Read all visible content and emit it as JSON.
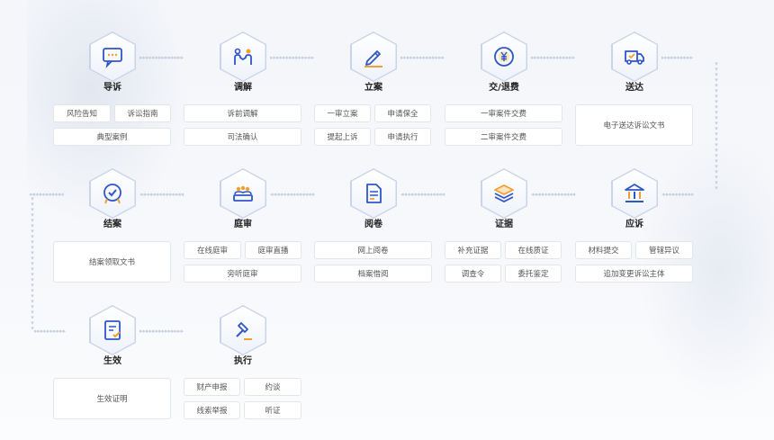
{
  "stages": [
    {
      "key": "daosu",
      "label": "导诉",
      "icon": "chat-icon",
      "tags": [
        "风险告知",
        "诉讼指南",
        "典型案例"
      ]
    },
    {
      "key": "tiaojie",
      "label": "调解",
      "icon": "mediation-icon",
      "tags": [
        "诉前调解",
        "司法确认"
      ]
    },
    {
      "key": "lian",
      "label": "立案",
      "icon": "pen-icon",
      "tags": [
        "一审立案",
        "申请保全",
        "提起上诉",
        "申请执行"
      ]
    },
    {
      "key": "jiaotuifei",
      "label": "交/退费",
      "icon": "yuan-icon",
      "tags": [
        "一审案件交费",
        "二审案件交费"
      ]
    },
    {
      "key": "songda",
      "label": "送达",
      "icon": "delivery-truck-icon",
      "tags": [
        "电子送达诉讼文书"
      ]
    },
    {
      "key": "yingsu",
      "label": "应诉",
      "icon": "courthouse-icon",
      "tags": [
        "材料提交",
        "管辖异议",
        "追加变更诉讼主体"
      ]
    },
    {
      "key": "zhengju",
      "label": "证据",
      "icon": "layers-icon",
      "tags": [
        "补充证据",
        "在线质证",
        "调查令",
        "委托鉴定"
      ]
    },
    {
      "key": "yuejuan",
      "label": "阅卷",
      "icon": "document-icon",
      "tags": [
        "网上阅卷",
        "档案借阅"
      ]
    },
    {
      "key": "tingshen",
      "label": "庭审",
      "icon": "courtroom-icon",
      "tags": [
        "在线庭审",
        "庭审直播",
        "旁听庭审"
      ]
    },
    {
      "key": "jiean",
      "label": "结案",
      "icon": "check-badge-icon",
      "tags": [
        "结案领取文书"
      ]
    },
    {
      "key": "shengxiao",
      "label": "生效",
      "icon": "certificate-icon",
      "tags": [
        "生效证明"
      ]
    },
    {
      "key": "zhixing",
      "label": "执行",
      "icon": "gavel-icon",
      "tags": [
        "财产申报",
        "约谈",
        "线索举报",
        "听证"
      ]
    }
  ],
  "colors": {
    "accent": "#2f56c9",
    "accent_light": "#8fa7e8",
    "orange": "#f0a032",
    "border": "#e2e5ea"
  }
}
